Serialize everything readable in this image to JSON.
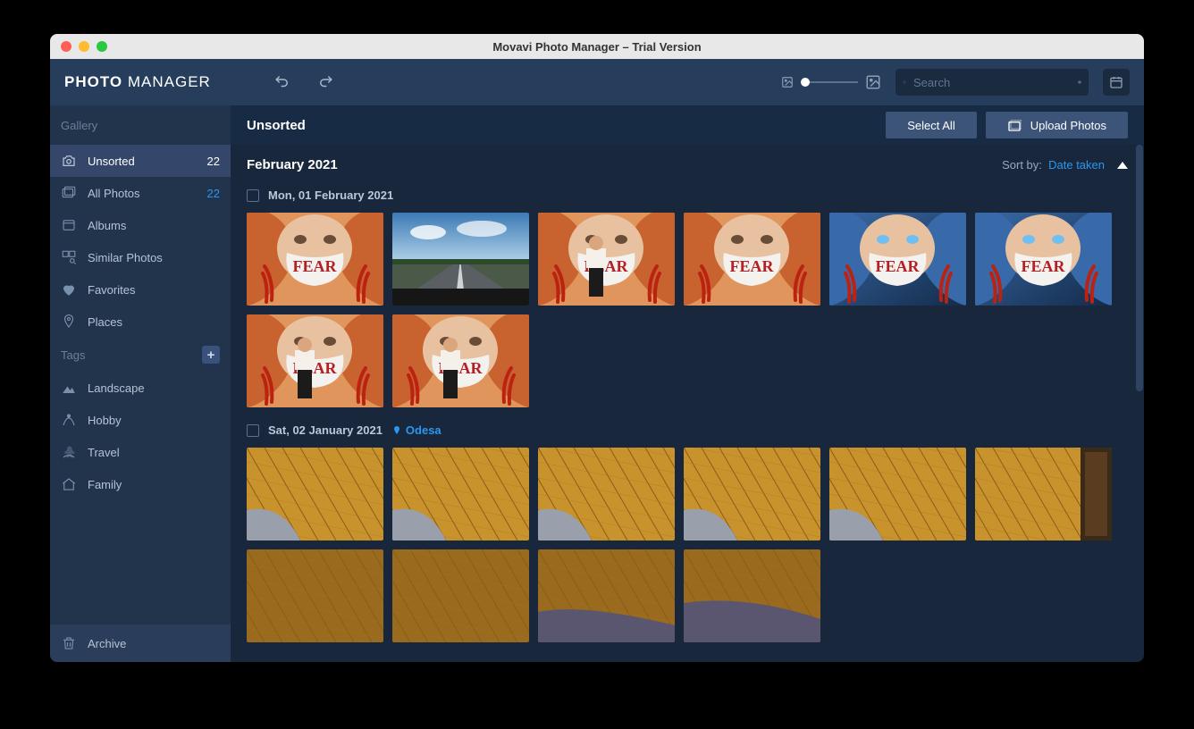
{
  "window": {
    "title": "Movavi Photo Manager – Trial Version"
  },
  "brand": {
    "bold": "PHOTO",
    "light": "MANAGER"
  },
  "search": {
    "placeholder": "Search"
  },
  "sidebar": {
    "header": "Gallery",
    "items": [
      {
        "label": "Unsorted",
        "count": "22",
        "active": true
      },
      {
        "label": "All Photos",
        "count": "22",
        "active": false
      },
      {
        "label": "Albums",
        "count": "",
        "active": false
      },
      {
        "label": "Similar Photos",
        "count": "",
        "active": false
      },
      {
        "label": "Favorites",
        "count": "",
        "active": false
      },
      {
        "label": "Places",
        "count": "",
        "active": false
      }
    ],
    "tags_header": "Tags",
    "tags": [
      {
        "label": "Landscape"
      },
      {
        "label": "Hobby"
      },
      {
        "label": "Travel"
      },
      {
        "label": "Family"
      }
    ],
    "archive": "Archive"
  },
  "content": {
    "title": "Unsorted",
    "select_all": "Select All",
    "upload": "Upload Photos",
    "month": "February 2021",
    "sort_label": "Sort by:",
    "sort_value": "Date taken",
    "groups": [
      {
        "date": "Mon, 01 February 2021",
        "location": "",
        "thumb_count": 8
      },
      {
        "date": "Sat, 02 January 2021",
        "location": "Odesa",
        "thumb_count": 10
      }
    ]
  }
}
